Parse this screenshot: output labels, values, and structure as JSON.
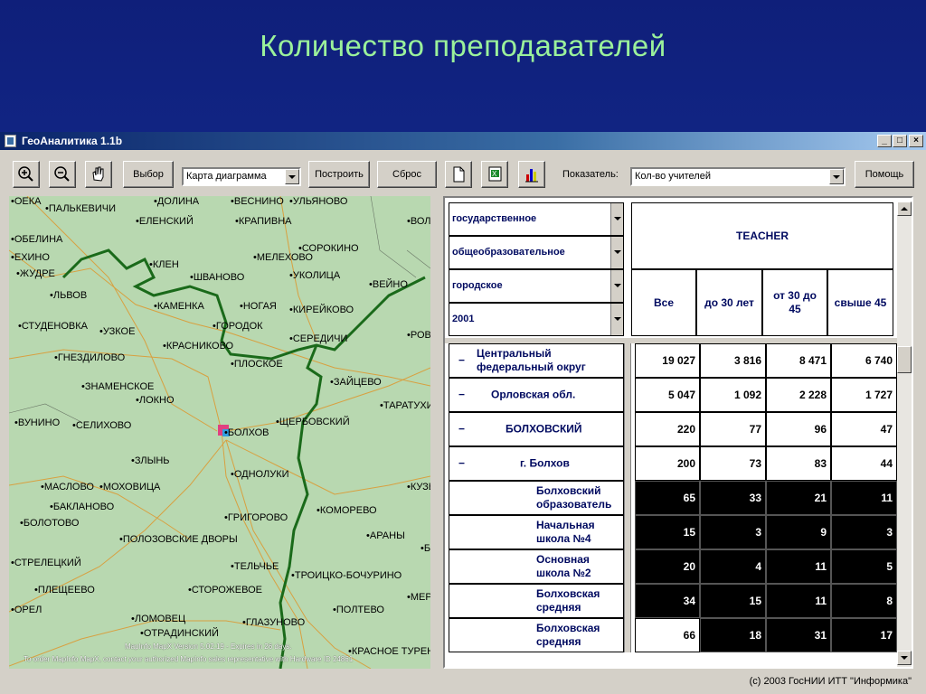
{
  "slide": {
    "title": "Количество преподавателей"
  },
  "window": {
    "title": "ГеоАналитика 1.1b",
    "min": "_",
    "max": "□",
    "close": "×"
  },
  "toolbar": {
    "select_label": "Выбор",
    "map_type_value": "Карта диаграмма",
    "build_label": "Построить",
    "reset_label": "Сброс",
    "indicator_label": "Показатель:",
    "indicator_value": "Кол-во учителей",
    "help_label": "Помощь"
  },
  "map": {
    "towns": [
      "ОЕКА",
      "ПАЛЬКЕВИЧИ",
      "ДОЛИНА",
      "ВЕСНИНО",
      "УЛЬЯНОВО",
      "ВОЛ",
      "ОБЕЛИНА",
      "ЕЛЕНСКИЙ",
      "КРАПИВНА",
      "ЕХИНО",
      "ЖУДРЕ",
      "КЛЕН",
      "МЕЛЕХОВО",
      "СОРОКИНО",
      "ШВАНОВО",
      "УКОЛИЦА",
      "ВЕЙНО",
      "ЛЬВОВ",
      "КАМЕНКА",
      "НОГАЯ",
      "КИРЕЙКОВО",
      "СТУДЕНОВКА",
      "УЗКОЕ",
      "ГОРОДОК",
      "СЕРЕДИЧИ",
      "РОВНО",
      "КРАСНИКОВО",
      "ГНЕЗДИЛОВО",
      "ПЛОСКОЕ",
      "ЗНАМЕНСКОЕ",
      "ЛОКНО",
      "ЗАЙЦЕВО",
      "ТАРАТУХИН",
      "ВУНИНО",
      "СЕЛИХОВО",
      "ЩЕРБОВСКИЙ",
      "БОЛХОВ",
      "ЗЛЫНЬ",
      "ОДНОЛУКИ",
      "МАСЛОВО",
      "МОХОВИЦА",
      "КУЗЬМ",
      "БАКЛАНОВО",
      "ГРИГОРОВО",
      "КОМОРЕВО",
      "БОЛОТОВО",
      "ПОЛОЗОВСКИЕ ДВОРЫ",
      "АРАНЫ",
      "БАЙ",
      "СТРЕЛЕЦКИЙ",
      "ТЕЛЬЧЬЕ",
      "ТРОИЦКО-БОЧУРИНО",
      "ПЛЕЩЕЕВО",
      "СТОРОЖЕВОЕ",
      "МЕРК",
      "ОРЕЛ",
      "ЛОМОВЕЦ",
      "ПОЛТЕВО",
      "ОТРАДИНСКИЙ",
      "ГЛАЗУНОВО",
      "КРАСНОЕ ТУРЕН"
    ],
    "credit_line1": "MapInfo MapX Version 5.02.19 - Expires in 26 days.",
    "credit_line2": "To order MapInfo MapX, contact your authorized MapInfo sales representative with Hardware ID 24861"
  },
  "filters": [
    "государственное",
    "общеобразовательное",
    "городское",
    "2001"
  ],
  "table": {
    "group_header": "TEACHER",
    "columns": [
      "Все",
      "до 30 лет",
      "от 30 до 45",
      "свыше 45"
    ],
    "rows": [
      {
        "marker": "−",
        "label": "Центральный федеральный округ",
        "values": [
          "19 027",
          "3 816",
          "8 471",
          "6 740"
        ],
        "dark": false
      },
      {
        "marker": "−",
        "label": "Орловская обл.",
        "values": [
          "5 047",
          "1 092",
          "2 228",
          "1 727"
        ],
        "dark": false
      },
      {
        "marker": "−",
        "label": "БОЛХОВСКИЙ",
        "values": [
          "220",
          "77",
          "96",
          "47"
        ],
        "dark": false
      },
      {
        "marker": "−",
        "label": "г. Болхов",
        "values": [
          "200",
          "73",
          "83",
          "44"
        ],
        "dark": false
      },
      {
        "marker": "",
        "label": "Болховский образователь",
        "values": [
          "65",
          "33",
          "21",
          "11"
        ],
        "dark": true
      },
      {
        "marker": "",
        "label": "Начальная школа №4",
        "values": [
          "15",
          "3",
          "9",
          "3"
        ],
        "dark": true
      },
      {
        "marker": "",
        "label": "Основная школа №2",
        "values": [
          "20",
          "4",
          "11",
          "5"
        ],
        "dark": true
      },
      {
        "marker": "",
        "label": "Болховская средняя",
        "values": [
          "34",
          "15",
          "11",
          "8"
        ],
        "dark": true
      },
      {
        "marker": "",
        "label": "Болховская средняя",
        "values": [
          "66",
          "18",
          "31",
          "17"
        ],
        "dark": true
      }
    ]
  },
  "footer": {
    "copyright": "(c) 2003 ГосНИИ ИТТ \"Информика\""
  }
}
